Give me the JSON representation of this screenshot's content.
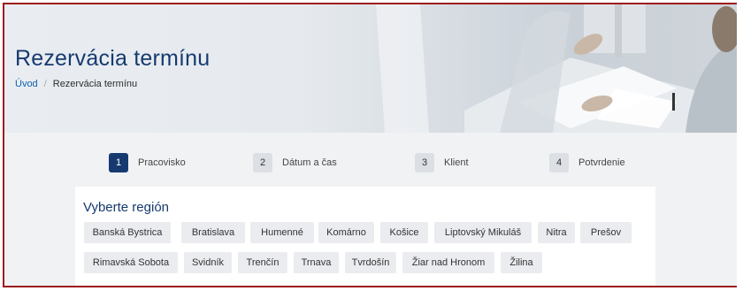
{
  "header": {
    "title": "Rezervácia termínu"
  },
  "breadcrumb": {
    "home": "Úvod",
    "current": "Rezervácia termínu"
  },
  "steps": [
    {
      "num": "1",
      "label": "Pracovisko",
      "active": true
    },
    {
      "num": "2",
      "label": "Dátum a čas",
      "active": false
    },
    {
      "num": "3",
      "label": "Klient",
      "active": false
    },
    {
      "num": "4",
      "label": "Potvrdenie",
      "active": false
    }
  ],
  "region_section": {
    "title": "Vyberte región",
    "regions": [
      "Banská Bystrica",
      "Bratislava",
      "Humenné",
      "Komárno",
      "Košice",
      "Liptovský Mikuláš",
      "Nitra",
      "Prešov",
      "Rimavská Sobota",
      "Svidník",
      "Trenčín",
      "Trnava",
      "Tvrdošín",
      "Žiar nad Hronom",
      "Žilina"
    ]
  },
  "colors": {
    "primary": "#163a70",
    "border": "#9e1b1b",
    "chip": "#eaecef"
  }
}
